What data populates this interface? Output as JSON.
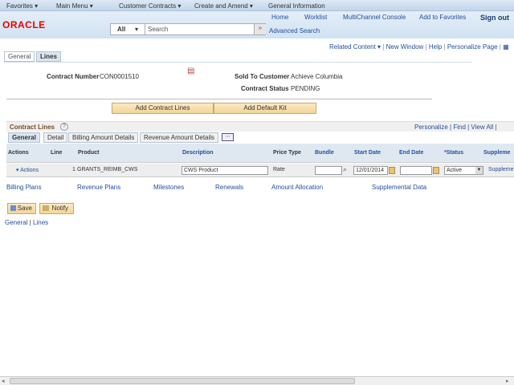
{
  "topbar": {
    "favorites": "Favorites ▾",
    "main_menu": "Main Menu ▾",
    "customer_contracts": "Customer Contracts ▾",
    "create_amend": "Create and Amend ▾",
    "current": "General Information"
  },
  "header": {
    "logo": "ORACLE",
    "links": [
      "Home",
      "Worklist",
      "MultiChannel Console",
      "Add to Favorites",
      "Sign out"
    ],
    "search_scope": "All",
    "search_placeholder": "Search",
    "advanced_search": "Advanced Search"
  },
  "toolbar": {
    "related": "Related Content ▾",
    "new_window": "New Window",
    "help": "Help",
    "personalize": "Personalize Page"
  },
  "page_tabs": [
    "General",
    "Lines"
  ],
  "contract": {
    "number_label": "Contract Number",
    "number": "CON0001510",
    "customer_label": "Sold To Customer",
    "customer": "Achieve Columbia",
    "status_label": "Contract Status",
    "status": "PENDING"
  },
  "buttons": {
    "add_lines": "Add Contract Lines",
    "add_kit": "Add Default Kit",
    "save": "Save",
    "notify": "Notify"
  },
  "grid": {
    "title": "Contract Lines",
    "nav": "Personalize | Find | View All |",
    "tabs": [
      "General",
      "Detail",
      "Billing Amount Details",
      "Revenue Amount Details"
    ],
    "columns": [
      "Actions",
      "Line",
      "Product",
      "Description",
      "Price Type",
      "Bundle",
      "Start Date",
      "End Date",
      "*Status",
      "Suppleme"
    ],
    "row": {
      "actions": "▾ Actions",
      "line": "1",
      "product": "GRANTS_REIMB_CWS",
      "description": "CWS Product",
      "price_type": "Rate",
      "bundle": "",
      "start_date": "12/01/2014",
      "end_date": "",
      "status": "Active",
      "supplemental": "Suppleme"
    }
  },
  "links": [
    "Billing Plans",
    "Revenue Plans",
    "Milestones",
    "Renewals",
    "Amount Allocation",
    "Supplemental Data"
  ],
  "bottom_nav": {
    "general": "General",
    "sep": "|",
    "lines": "Lines"
  }
}
